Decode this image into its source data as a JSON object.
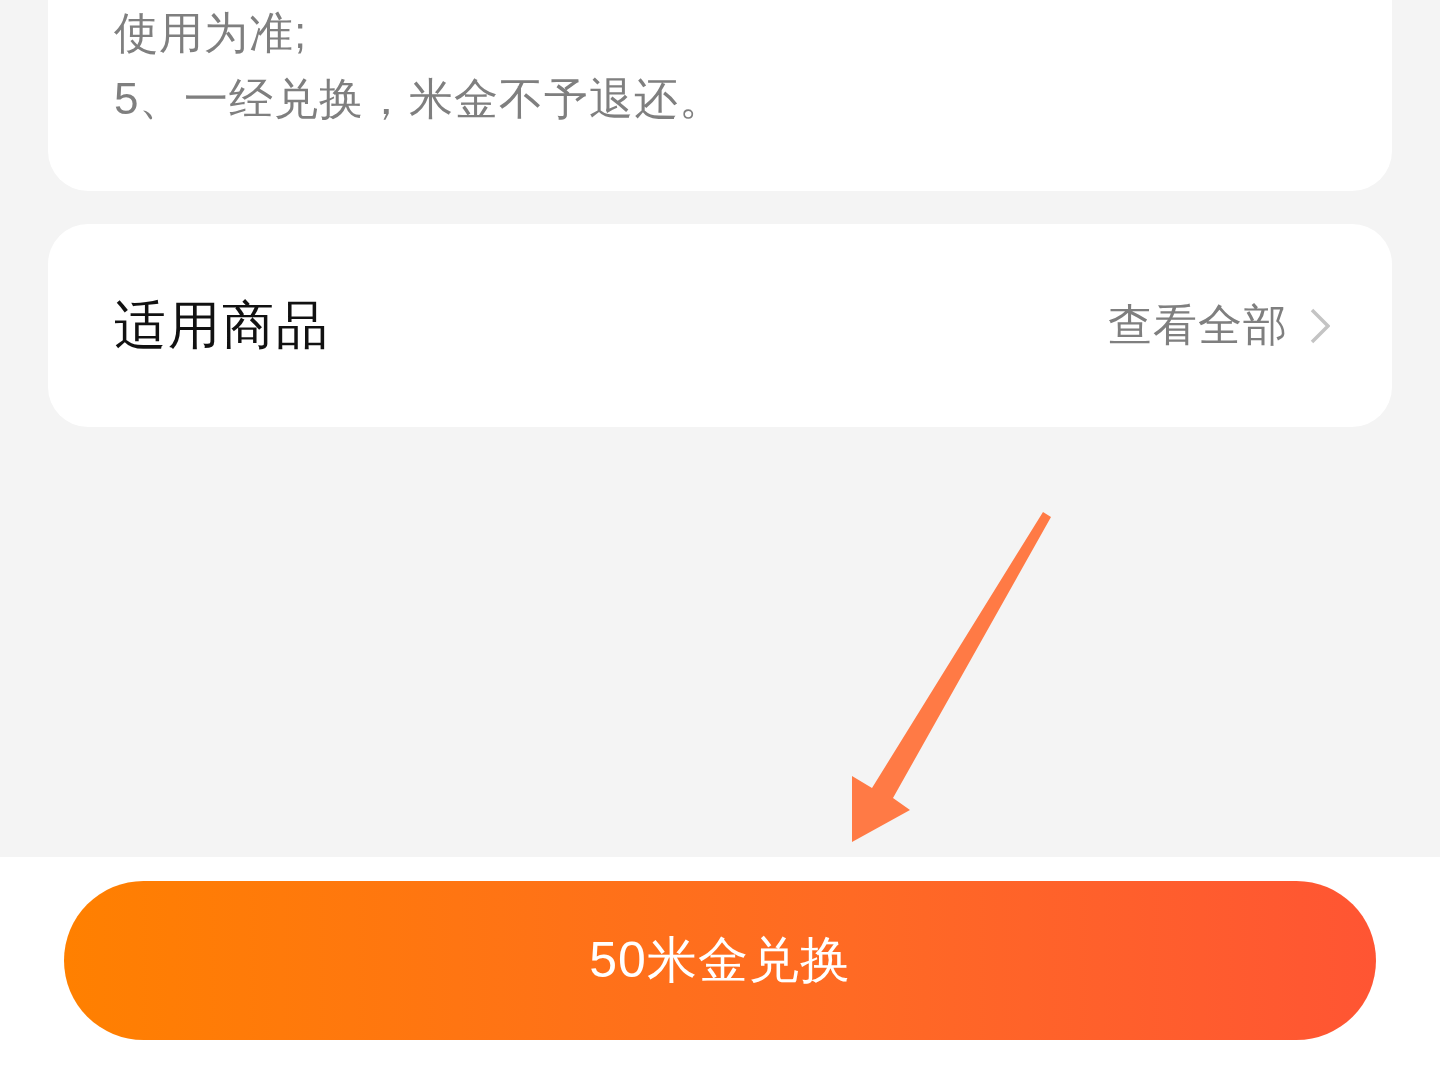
{
  "rules_card": {
    "lines": [
      "使用为准;",
      "5、一经兑换，米金不予退还。"
    ]
  },
  "applicable_products": {
    "title": "适用商品",
    "link": "查看全部"
  },
  "bottom_bar": {
    "button": "50米金兑换"
  }
}
